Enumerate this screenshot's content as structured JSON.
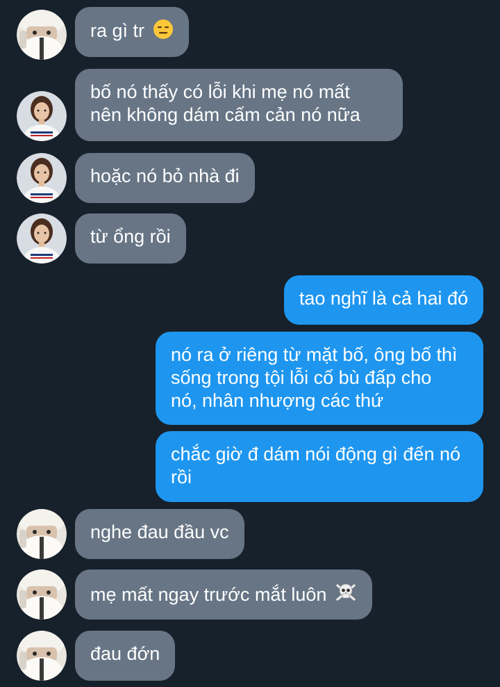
{
  "messages": [
    {
      "direction": "in",
      "sender": "girl",
      "text": "ra gì tr",
      "emoji": "expressionless-face-icon"
    },
    {
      "direction": "in",
      "sender": "woman",
      "lines": [
        "bố nó thấy có lỗi khi mẹ nó mất",
        "nên không dám cấm cản nó nữa"
      ]
    },
    {
      "direction": "in",
      "sender": "woman",
      "text": "hoặc nó bỏ nhà đi"
    },
    {
      "direction": "in",
      "sender": "woman",
      "text": "từ ổng rồi"
    },
    {
      "direction": "out",
      "text": "tao nghĩ là cả hai đó"
    },
    {
      "direction": "out",
      "lines": [
        "nó ra ở riêng từ mặt bố, ông bố thì",
        "sống trong tội lỗi cố bù đấp cho",
        "nó, nhân nhượng các thứ"
      ]
    },
    {
      "direction": "out",
      "lines": [
        "chắc giờ đ dám nói động gì đến nó",
        "rồi"
      ]
    },
    {
      "direction": "in",
      "sender": "girl",
      "text": "nghe đau đầu vc"
    },
    {
      "direction": "in",
      "sender": "girl",
      "text": "mẹ mất ngay trước mắt luôn",
      "emoji": "skull-crossbones-icon"
    },
    {
      "direction": "in",
      "sender": "girl",
      "text": "đau đớn"
    }
  ],
  "colors": {
    "background": "#17212b",
    "incoming_bubble": "#677585",
    "outgoing_bubble": "#1e96f0",
    "text": "#ffffff"
  }
}
